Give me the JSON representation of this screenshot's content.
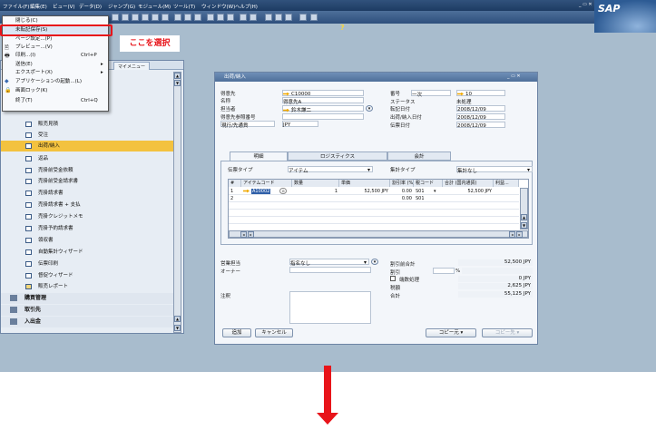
{
  "menubar": {
    "items": [
      "ファイル(F)",
      "編集(E)",
      "ビュー(V)",
      "データ(D)",
      "ジャンプ(G)",
      "モジュール(M)",
      "ツール(T)",
      "ウィンドウ(W)",
      "ヘルプ(H)"
    ]
  },
  "brand": {
    "logo": "SAP"
  },
  "file_menu": {
    "items": [
      {
        "label": "閉じる(C)",
        "shortcut": "",
        "submenu": false,
        "icon": ""
      },
      {
        "label": "未転記保存(S)",
        "shortcut": "",
        "submenu": false,
        "icon": ""
      },
      {
        "label": "ページ設定...(P)",
        "shortcut": "",
        "submenu": false,
        "icon": ""
      },
      {
        "label": "プレビュー...(V)",
        "shortcut": "",
        "submenu": false,
        "icon": "preview-icon"
      },
      {
        "label": "印刷...(I)",
        "shortcut": "Ctrl+P",
        "submenu": false,
        "icon": "printer-icon"
      },
      {
        "label": "送信(E)",
        "shortcut": "",
        "submenu": true,
        "icon": ""
      },
      {
        "label": "エクスポート(X)",
        "shortcut": "",
        "submenu": true,
        "icon": ""
      },
      {
        "label": "アプリケーションの起動...(L)",
        "shortcut": "",
        "submenu": false,
        "icon": "launch-icon"
      },
      {
        "label": "画面ロック(K)",
        "shortcut": "",
        "submenu": false,
        "icon": "lock-icon"
      },
      {
        "label": "終了(T)",
        "shortcut": "Ctrl+Q",
        "submenu": false,
        "icon": ""
      }
    ]
  },
  "callout": {
    "text": "ここを選択"
  },
  "left_panel": {
    "tab": "マイメニュー",
    "items": [
      "販売見積",
      "受注",
      "出荷/納入",
      "返品",
      "売掛前受金依頼",
      "売掛前受金請求書",
      "売掛請求書",
      "売掛請求書 + 支払",
      "売掛クレジットメモ",
      "売掛予約請求書",
      "領収書",
      "自動集計ウィザード",
      "伝票印刷",
      "督促ウィザード",
      "販売レポート"
    ],
    "selected_index": 2,
    "modules": [
      "購買管理",
      "取引先",
      "入出金"
    ]
  },
  "window": {
    "title": "出荷/納入",
    "header_left": [
      {
        "label": "得意先",
        "value": "C10000"
      },
      {
        "label": "名称",
        "value": "得意先A"
      },
      {
        "label": "担当者",
        "value": "鈴木謙二"
      },
      {
        "label": "得意先参照番号",
        "value": ""
      },
      {
        "label": "現行/先通貨",
        "value": "JPY"
      }
    ],
    "header_right": [
      {
        "label": "番号",
        "series": "一次",
        "value": "10"
      },
      {
        "label": "ステータス",
        "value": "未処理"
      },
      {
        "label": "転記日付",
        "value": "2008/12/09"
      },
      {
        "label": "出荷/納入日付",
        "value": "2008/12/09"
      },
      {
        "label": "伝票日付",
        "value": "2008/12/09"
      }
    ],
    "tabs": [
      "明細",
      "ロジスティクス",
      "会計"
    ],
    "item_type_label": "伝票タイプ",
    "item_type_value": "アイテム",
    "summary_type_label": "集計タイプ",
    "summary_type_value": "集計なし",
    "grid_headers": [
      "#",
      "アイテムコード",
      "数量",
      "単価",
      "割引率 (%)",
      "税コード",
      "合計 (国内通貨)",
      "利益..."
    ],
    "grid_rows": [
      {
        "num": "1",
        "code": "A10002",
        "qty": "1",
        "price": "52,500 JPY",
        "disc": "0.00",
        "tax": "S01",
        "total": "52,500 JPY"
      },
      {
        "num": "2",
        "code": "",
        "qty": "",
        "price": "",
        "disc": "0.00",
        "tax": "S01",
        "total": ""
      }
    ],
    "footer_left": [
      {
        "label": "営業担当",
        "value": "指名なし"
      },
      {
        "label": "オーナー",
        "value": ""
      },
      {
        "label": "注釈",
        "value": ""
      }
    ],
    "footer_right": [
      {
        "label": "割引前合計",
        "value": "52,500 JPY"
      },
      {
        "label": "割引",
        "value": "",
        "pct": "%"
      },
      {
        "label": "端数処理",
        "value": "0 JPY"
      },
      {
        "label": "税額",
        "value": "2,625 JPY"
      },
      {
        "label": "合計",
        "value": "55,125 JPY"
      }
    ],
    "buttons": {
      "add": "追加",
      "cancel": "キャンセル",
      "copy_from": "コピー元",
      "copy_to": "コピー先"
    }
  },
  "colors": {
    "highlight": "#e8141a",
    "selected_row": "#f3c23f",
    "background": "#a8bccd"
  }
}
